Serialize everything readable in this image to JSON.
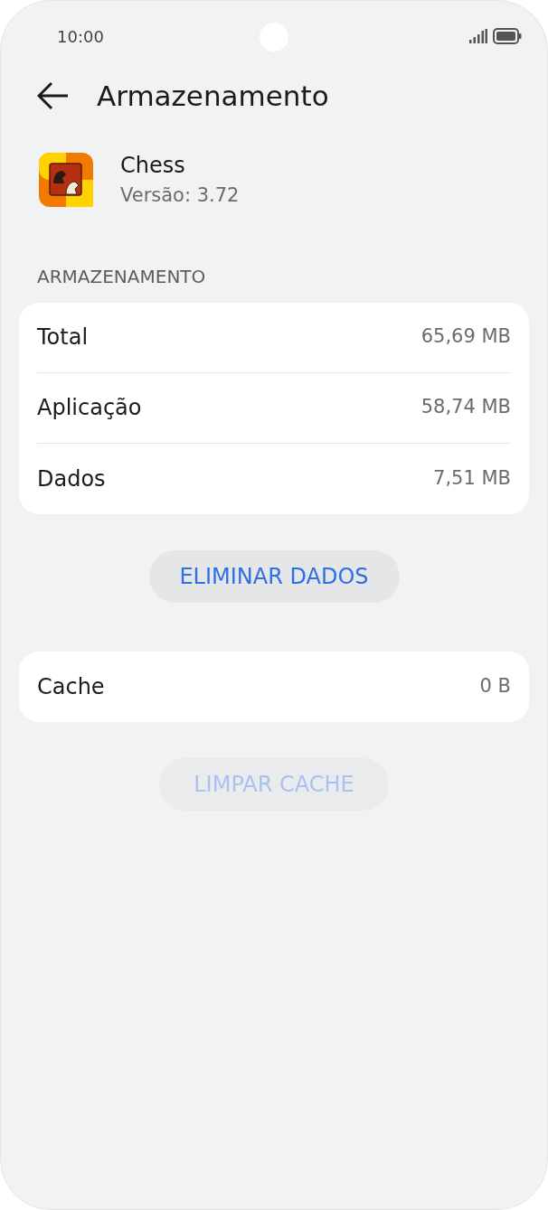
{
  "status_bar": {
    "time": "10:00"
  },
  "header": {
    "title": "Armazenamento"
  },
  "app": {
    "name": "Chess",
    "version": "Versão: 3.72"
  },
  "section_label": "ARMAZENAMENTO",
  "storage_rows": [
    {
      "label": "Total",
      "value": "65,69 MB"
    },
    {
      "label": "Aplicação",
      "value": "58,74 MB"
    },
    {
      "label": "Dados",
      "value": "7,51 MB"
    }
  ],
  "clear_data_button": {
    "label": "ELIMINAR DADOS",
    "disabled": false
  },
  "cache_rows": [
    {
      "label": "Cache",
      "value": "0 B"
    }
  ],
  "clear_cache_button": {
    "label": "LIMPAR CACHE",
    "disabled": true
  }
}
